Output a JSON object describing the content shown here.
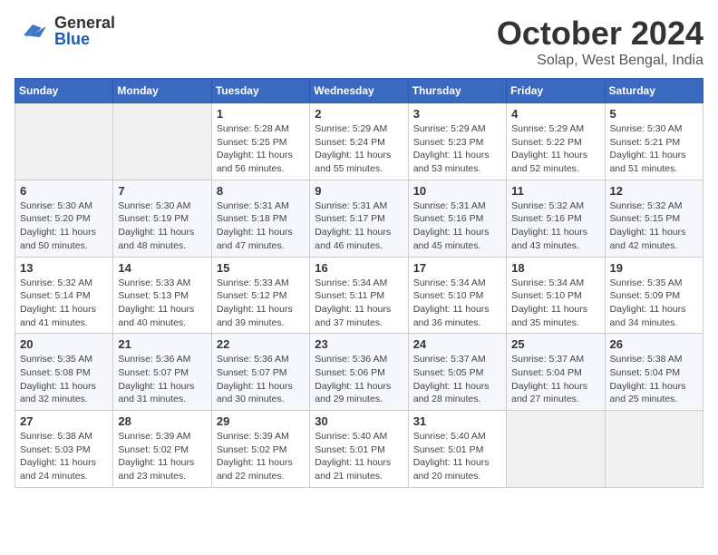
{
  "header": {
    "logo_general": "General",
    "logo_blue": "Blue",
    "month": "October 2024",
    "location": "Solap, West Bengal, India"
  },
  "days_of_week": [
    "Sunday",
    "Monday",
    "Tuesday",
    "Wednesday",
    "Thursday",
    "Friday",
    "Saturday"
  ],
  "weeks": [
    [
      {
        "day": "",
        "sunrise": "",
        "sunset": "",
        "daylight": ""
      },
      {
        "day": "",
        "sunrise": "",
        "sunset": "",
        "daylight": ""
      },
      {
        "day": "1",
        "sunrise": "Sunrise: 5:28 AM",
        "sunset": "Sunset: 5:25 PM",
        "daylight": "Daylight: 11 hours and 56 minutes."
      },
      {
        "day": "2",
        "sunrise": "Sunrise: 5:29 AM",
        "sunset": "Sunset: 5:24 PM",
        "daylight": "Daylight: 11 hours and 55 minutes."
      },
      {
        "day": "3",
        "sunrise": "Sunrise: 5:29 AM",
        "sunset": "Sunset: 5:23 PM",
        "daylight": "Daylight: 11 hours and 53 minutes."
      },
      {
        "day": "4",
        "sunrise": "Sunrise: 5:29 AM",
        "sunset": "Sunset: 5:22 PM",
        "daylight": "Daylight: 11 hours and 52 minutes."
      },
      {
        "day": "5",
        "sunrise": "Sunrise: 5:30 AM",
        "sunset": "Sunset: 5:21 PM",
        "daylight": "Daylight: 11 hours and 51 minutes."
      }
    ],
    [
      {
        "day": "6",
        "sunrise": "Sunrise: 5:30 AM",
        "sunset": "Sunset: 5:20 PM",
        "daylight": "Daylight: 11 hours and 50 minutes."
      },
      {
        "day": "7",
        "sunrise": "Sunrise: 5:30 AM",
        "sunset": "Sunset: 5:19 PM",
        "daylight": "Daylight: 11 hours and 48 minutes."
      },
      {
        "day": "8",
        "sunrise": "Sunrise: 5:31 AM",
        "sunset": "Sunset: 5:18 PM",
        "daylight": "Daylight: 11 hours and 47 minutes."
      },
      {
        "day": "9",
        "sunrise": "Sunrise: 5:31 AM",
        "sunset": "Sunset: 5:17 PM",
        "daylight": "Daylight: 11 hours and 46 minutes."
      },
      {
        "day": "10",
        "sunrise": "Sunrise: 5:31 AM",
        "sunset": "Sunset: 5:16 PM",
        "daylight": "Daylight: 11 hours and 45 minutes."
      },
      {
        "day": "11",
        "sunrise": "Sunrise: 5:32 AM",
        "sunset": "Sunset: 5:16 PM",
        "daylight": "Daylight: 11 hours and 43 minutes."
      },
      {
        "day": "12",
        "sunrise": "Sunrise: 5:32 AM",
        "sunset": "Sunset: 5:15 PM",
        "daylight": "Daylight: 11 hours and 42 minutes."
      }
    ],
    [
      {
        "day": "13",
        "sunrise": "Sunrise: 5:32 AM",
        "sunset": "Sunset: 5:14 PM",
        "daylight": "Daylight: 11 hours and 41 minutes."
      },
      {
        "day": "14",
        "sunrise": "Sunrise: 5:33 AM",
        "sunset": "Sunset: 5:13 PM",
        "daylight": "Daylight: 11 hours and 40 minutes."
      },
      {
        "day": "15",
        "sunrise": "Sunrise: 5:33 AM",
        "sunset": "Sunset: 5:12 PM",
        "daylight": "Daylight: 11 hours and 39 minutes."
      },
      {
        "day": "16",
        "sunrise": "Sunrise: 5:34 AM",
        "sunset": "Sunset: 5:11 PM",
        "daylight": "Daylight: 11 hours and 37 minutes."
      },
      {
        "day": "17",
        "sunrise": "Sunrise: 5:34 AM",
        "sunset": "Sunset: 5:10 PM",
        "daylight": "Daylight: 11 hours and 36 minutes."
      },
      {
        "day": "18",
        "sunrise": "Sunrise: 5:34 AM",
        "sunset": "Sunset: 5:10 PM",
        "daylight": "Daylight: 11 hours and 35 minutes."
      },
      {
        "day": "19",
        "sunrise": "Sunrise: 5:35 AM",
        "sunset": "Sunset: 5:09 PM",
        "daylight": "Daylight: 11 hours and 34 minutes."
      }
    ],
    [
      {
        "day": "20",
        "sunrise": "Sunrise: 5:35 AM",
        "sunset": "Sunset: 5:08 PM",
        "daylight": "Daylight: 11 hours and 32 minutes."
      },
      {
        "day": "21",
        "sunrise": "Sunrise: 5:36 AM",
        "sunset": "Sunset: 5:07 PM",
        "daylight": "Daylight: 11 hours and 31 minutes."
      },
      {
        "day": "22",
        "sunrise": "Sunrise: 5:36 AM",
        "sunset": "Sunset: 5:07 PM",
        "daylight": "Daylight: 11 hours and 30 minutes."
      },
      {
        "day": "23",
        "sunrise": "Sunrise: 5:36 AM",
        "sunset": "Sunset: 5:06 PM",
        "daylight": "Daylight: 11 hours and 29 minutes."
      },
      {
        "day": "24",
        "sunrise": "Sunrise: 5:37 AM",
        "sunset": "Sunset: 5:05 PM",
        "daylight": "Daylight: 11 hours and 28 minutes."
      },
      {
        "day": "25",
        "sunrise": "Sunrise: 5:37 AM",
        "sunset": "Sunset: 5:04 PM",
        "daylight": "Daylight: 11 hours and 27 minutes."
      },
      {
        "day": "26",
        "sunrise": "Sunrise: 5:38 AM",
        "sunset": "Sunset: 5:04 PM",
        "daylight": "Daylight: 11 hours and 25 minutes."
      }
    ],
    [
      {
        "day": "27",
        "sunrise": "Sunrise: 5:38 AM",
        "sunset": "Sunset: 5:03 PM",
        "daylight": "Daylight: 11 hours and 24 minutes."
      },
      {
        "day": "28",
        "sunrise": "Sunrise: 5:39 AM",
        "sunset": "Sunset: 5:02 PM",
        "daylight": "Daylight: 11 hours and 23 minutes."
      },
      {
        "day": "29",
        "sunrise": "Sunrise: 5:39 AM",
        "sunset": "Sunset: 5:02 PM",
        "daylight": "Daylight: 11 hours and 22 minutes."
      },
      {
        "day": "30",
        "sunrise": "Sunrise: 5:40 AM",
        "sunset": "Sunset: 5:01 PM",
        "daylight": "Daylight: 11 hours and 21 minutes."
      },
      {
        "day": "31",
        "sunrise": "Sunrise: 5:40 AM",
        "sunset": "Sunset: 5:01 PM",
        "daylight": "Daylight: 11 hours and 20 minutes."
      },
      {
        "day": "",
        "sunrise": "",
        "sunset": "",
        "daylight": ""
      },
      {
        "day": "",
        "sunrise": "",
        "sunset": "",
        "daylight": ""
      }
    ]
  ],
  "colors": {
    "header_bg": "#3a6abf",
    "accent": "#1a5fb4"
  }
}
